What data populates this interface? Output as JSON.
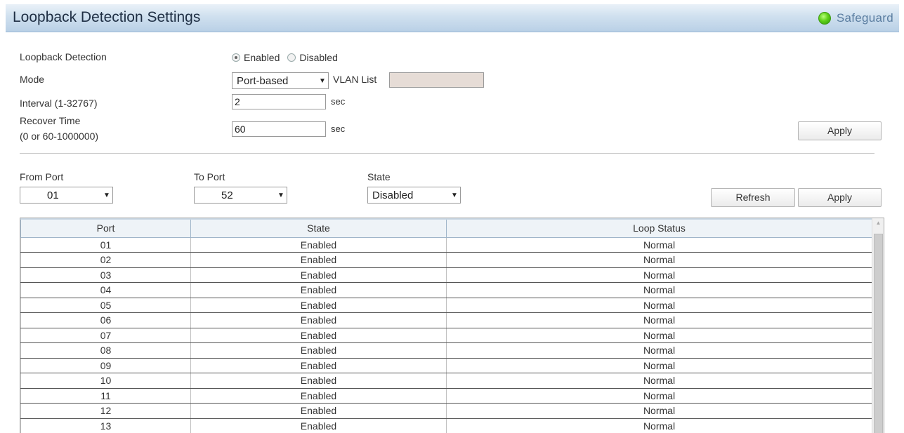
{
  "header": {
    "title": "Loopback Detection Settings",
    "safeguard": "Safeguard"
  },
  "settings": {
    "loopback_label": "Loopback Detection",
    "enabled_label": "Enabled",
    "disabled_label": "Disabled",
    "loopback_value": "Enabled",
    "mode_label": "Mode",
    "mode_value": "Port-based",
    "vlan_list_label": "VLAN List",
    "vlan_list_value": "",
    "interval_label": "Interval (1-32767)",
    "interval_value": "2",
    "interval_unit": "sec",
    "recover_label_line1": "Recover Time",
    "recover_label_line2": "(0 or 60-1000000)",
    "recover_value": "60",
    "recover_unit": "sec",
    "apply_label": "Apply"
  },
  "port_settings": {
    "from_port_label": "From Port",
    "from_port_value": "01",
    "to_port_label": "To Port",
    "to_port_value": "52",
    "state_label": "State",
    "state_value": "Disabled",
    "refresh_label": "Refresh",
    "apply_label": "Apply"
  },
  "table": {
    "columns": [
      "Port",
      "State",
      "Loop Status"
    ],
    "rows": [
      [
        "01",
        "Enabled",
        "Normal"
      ],
      [
        "02",
        "Enabled",
        "Normal"
      ],
      [
        "03",
        "Enabled",
        "Normal"
      ],
      [
        "04",
        "Enabled",
        "Normal"
      ],
      [
        "05",
        "Enabled",
        "Normal"
      ],
      [
        "06",
        "Enabled",
        "Normal"
      ],
      [
        "07",
        "Enabled",
        "Normal"
      ],
      [
        "08",
        "Enabled",
        "Normal"
      ],
      [
        "09",
        "Enabled",
        "Normal"
      ],
      [
        "10",
        "Enabled",
        "Normal"
      ],
      [
        "11",
        "Enabled",
        "Normal"
      ],
      [
        "12",
        "Enabled",
        "Normal"
      ],
      [
        "13",
        "Enabled",
        "Normal"
      ]
    ]
  },
  "icons": {
    "safeguard": "green-status-dot-icon",
    "dropdown": "dropdown-arrow-icon",
    "scroll_up": "scroll-up-arrow-icon"
  },
  "colors": {
    "titlebar": "#cfe0ef",
    "safeguard_dot": "#5fd019",
    "table_header": "#eef3f7"
  }
}
